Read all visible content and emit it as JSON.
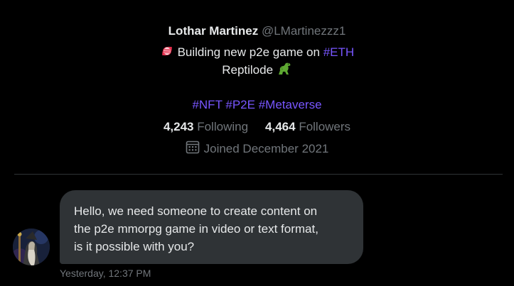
{
  "profile": {
    "display_name": "Lothar Martinez",
    "handle": "@LMartinezzz1",
    "bio_line1_prefix": "Building new p2e game on",
    "bio_line1_hashtag": "#ETH",
    "bio_line2_text": "Reptilode",
    "hashtags": [
      "#NFT",
      "#P2E",
      "#Metaverse"
    ],
    "following_count": "4,243",
    "following_label": "Following",
    "followers_count": "4,464",
    "followers_label": "Followers",
    "joined_text": "Joined December 2021"
  },
  "icons": {
    "bio_prefix_emoji": "candy-icon",
    "bio_suffix_emoji": "dinosaur-icon",
    "joined_icon": "calendar-icon"
  },
  "message": {
    "lines": [
      "Hello, we need someone to create content on",
      "the p2e mmorpg game in video or text format,",
      "is it possible with you?"
    ],
    "timestamp": "Yesterday, 12:37 PM"
  },
  "colors": {
    "background": "#000000",
    "text_primary": "#e7e9ea",
    "text_secondary": "#71767b",
    "hashtag": "#7856ff",
    "bubble": "#2f3336",
    "divider": "#2f3336"
  }
}
